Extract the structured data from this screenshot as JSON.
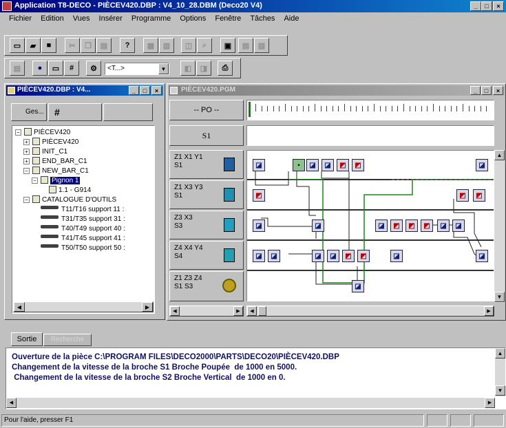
{
  "window": {
    "title": "Application T8-DECO - PIÈCEV420.DBP : V4_10_28.DBM (Deco20 V4)"
  },
  "menu": [
    "Fichier",
    "Edition",
    "Vues",
    "Insérer",
    "Programme",
    "Options",
    "Fenêtre",
    "Tâches",
    "Aide"
  ],
  "toolbar": {
    "combo_value": "<T...>"
  },
  "tree_window": {
    "title": "PIÈCEV420.DBP : V4...",
    "tabs": [
      "Ges...",
      "#",
      ""
    ],
    "items": [
      {
        "label": "PIÈCEV420",
        "level": 0,
        "expander": "−"
      },
      {
        "label": "PIÈCEV420",
        "level": 1,
        "expander": "+"
      },
      {
        "label": "INIT_C1",
        "level": 1,
        "expander": "+"
      },
      {
        "label": "END_BAR_C1",
        "level": 1,
        "expander": "+"
      },
      {
        "label": "NEW_BAR_C1",
        "level": 1,
        "expander": "−"
      },
      {
        "label": "Pignon 1",
        "level": 2,
        "expander": "−",
        "selected": true
      },
      {
        "label": "1.1 - G914",
        "level": 3,
        "expander": ""
      },
      {
        "label": "CATALOGUE D'OUTILS",
        "level": 1,
        "expander": "−"
      },
      {
        "label": "T11/T16 support 11 :",
        "level": 2,
        "tool": true
      },
      {
        "label": "T31/T35 support 31 :",
        "level": 2,
        "tool": true
      },
      {
        "label": "T40/T49 support 40 :",
        "level": 2,
        "tool": true
      },
      {
        "label": "T41/T45 support 41 :",
        "level": 2,
        "tool": true
      },
      {
        "label": "T50/T50 support 50 :",
        "level": 2,
        "tool": true
      }
    ]
  },
  "program_window": {
    "title": "PIÈCEV420.PGM",
    "po_label": "-- PO --",
    "s1_label": "S1",
    "rows": [
      {
        "line1": "Z1 X1 Y1",
        "line2": "S1"
      },
      {
        "line1": "Z1 X3 Y3",
        "line2": "S1"
      },
      {
        "line1": "Z3 X3",
        "line2": "S3"
      },
      {
        "line1": "Z4 X4 Y4",
        "line2": "S4"
      },
      {
        "line1": "Z1 Z3 Z4",
        "line2": "S1 S3"
      }
    ]
  },
  "output": {
    "tabs": [
      "Sortie",
      "Recherche"
    ],
    "lines": [
      "Ouverture de la pièce C:\\PROGRAM FILES\\DECO2000\\PARTS\\DECO20\\PIÈCEV420.DBP",
      "Changement de la vitesse de la broche S1 Broche Poupée  de 1000 en 5000.",
      " Changement de la vitesse de la broche S2 Broche Vertical  de 1000 en 0."
    ]
  },
  "statusbar": {
    "text": "Pour l'aide, presser F1"
  }
}
